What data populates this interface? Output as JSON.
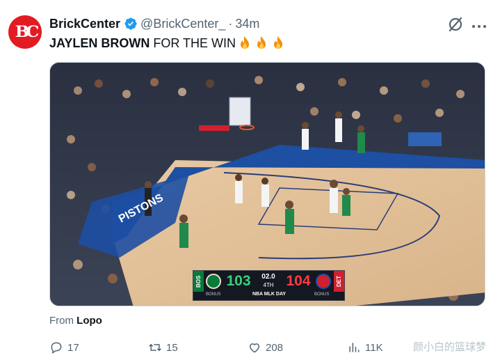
{
  "tweet": {
    "display_name": "BrickCenter",
    "handle": "@BrickCenter_",
    "separator": "·",
    "time": "34m",
    "text_bold": "JAYLEN BROWN",
    "text_rest": " FOR THE WIN",
    "emoji_count": 3
  },
  "avatar": {
    "logo_text": "BC",
    "color": "#e31b23"
  },
  "media": {
    "scoreboard": {
      "away_code": "BOS",
      "away_score": "103",
      "clock": "02.0",
      "quarter": "4TH",
      "home_score": "104",
      "home_code": "DET",
      "event": "NBA MLK DAY",
      "bonus_left": "BONUS",
      "bonus_right": "BONUS",
      "away_color": "#0a7a3b",
      "home_color": "#d0202f"
    }
  },
  "attribution": {
    "prefix": "From",
    "source": "Lopo"
  },
  "actions": {
    "replies": "17",
    "reposts": "15",
    "likes": "208",
    "views": "11K"
  },
  "watermark": "颜小白的篮球梦"
}
